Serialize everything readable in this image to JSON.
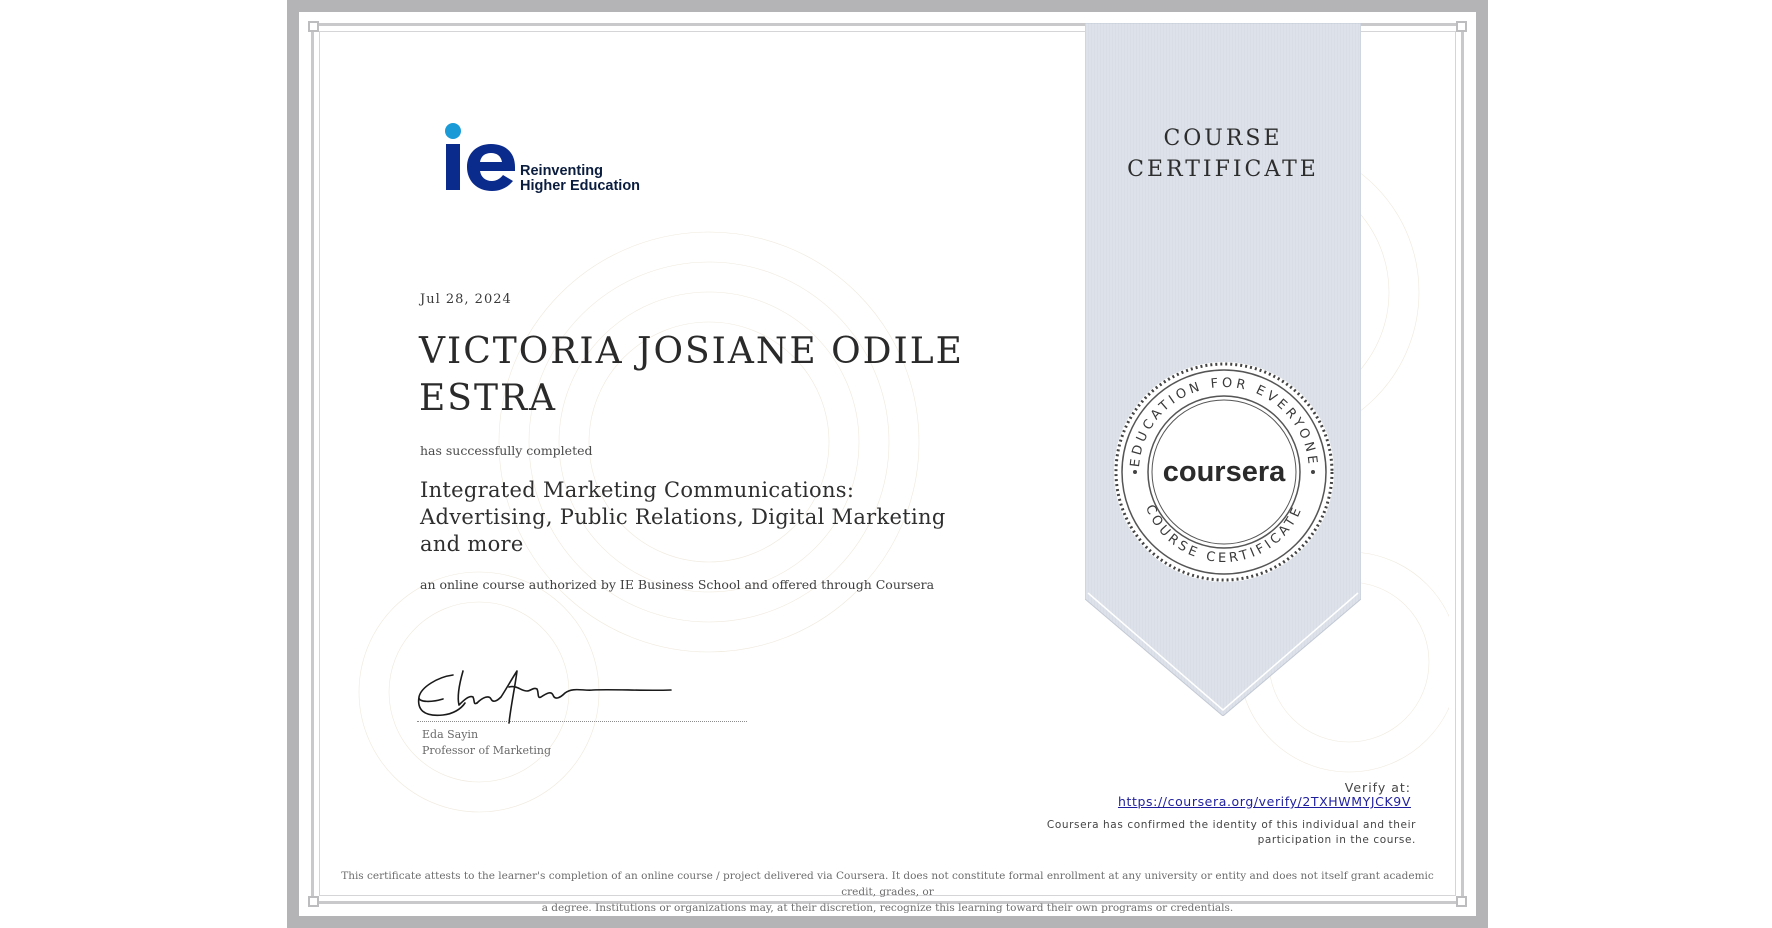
{
  "certificate": {
    "heading": [
      "COURSE",
      "CERTIFICATE"
    ],
    "logo": {
      "mark": "ie",
      "tagline": [
        "Reinventing",
        "Higher Education"
      ],
      "mark_color": "#0a2a8c",
      "dot_color": "#1a9bd7"
    },
    "date": "Jul 28, 2024",
    "recipient": [
      "VICTORIA JOSIANE ODILE",
      "ESTRA"
    ],
    "completed_text": "has successfully completed",
    "course_title": [
      "Integrated Marketing Communications:",
      "Advertising, Public Relations, Digital Marketing",
      "and more"
    ],
    "course_description": "an online course authorized by IE Business School and offered through Coursera",
    "signer": {
      "name": "Eda Sayin",
      "title": "Professor of Marketing"
    },
    "seal": {
      "top_text": "EDUCATION FOR EVERYONE",
      "bottom_text": "COURSE CERTIFICATE",
      "brand": "coursera"
    },
    "verify": {
      "label": "Verify at:",
      "url": "https://coursera.org/verify/2TXHWMYJCK9V",
      "note": "Coursera has confirmed the identity of this individual and their participation in the course."
    },
    "disclaimer": [
      "This certificate attests to the learner's completion of an online course / project delivered via Coursera. It does not constitute formal enrollment at any university or entity and does not itself grant academic credit, grades, or",
      "a degree. Institutions or organizations may, at their discretion, recognize this learning toward their own programs or credentials."
    ]
  },
  "colors": {
    "frame": "#b4b4b6",
    "ribbon": "#dde2ea",
    "link": "#1f1f9e"
  }
}
